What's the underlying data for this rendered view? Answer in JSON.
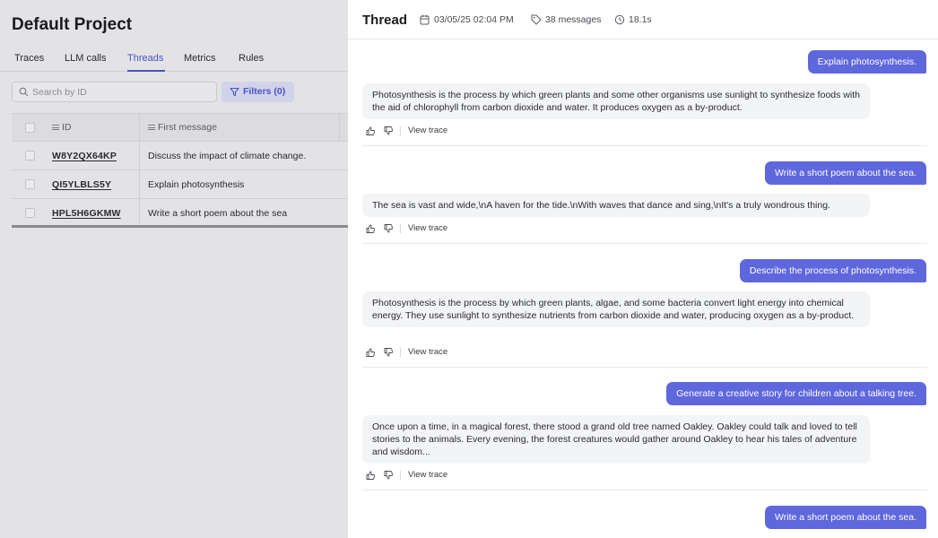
{
  "project": {
    "title": "Default Project"
  },
  "tabs": [
    {
      "label": "Traces"
    },
    {
      "label": "LLM calls"
    },
    {
      "label": "Threads",
      "active": true
    },
    {
      "label": "Metrics"
    },
    {
      "label": "Rules"
    }
  ],
  "search": {
    "placeholder": "Search by ID",
    "value": ""
  },
  "filters": {
    "label": "Filters (0)"
  },
  "table": {
    "headers": {
      "id": "ID",
      "first_message": "First message"
    },
    "rows": [
      {
        "id": "W8Y2QX64KP",
        "first_message": "Discuss the impact of climate change."
      },
      {
        "id": "QI5YLBLS5Y",
        "first_message": "Explain photosynthesis"
      },
      {
        "id": "HPL5H6GKMW",
        "first_message": "Write a short poem about the sea"
      }
    ]
  },
  "thread": {
    "title": "Thread",
    "date": "03/05/25 02:04 PM",
    "messages_count": "38 messages",
    "duration": "18.1s",
    "view_trace_label": "View trace",
    "exchanges": [
      {
        "user": "Explain photosynthesis.",
        "assistant": "Photosynthesis is the process by which green plants and some other organisms use sunlight to synthesize foods with the aid of chlorophyll from carbon dioxide and water. It produces oxygen as a by-product."
      },
      {
        "user": "Write a short poem about the sea.",
        "assistant": "The sea is vast and wide,\\nA haven for the tide.\\nWith waves that dance and sing,\\nIt's a truly wondrous thing."
      },
      {
        "user": "Describe the process of photosynthesis.",
        "assistant": "Photosynthesis is the process by which green plants, algae, and some bacteria convert light energy into chemical energy. They use sunlight to synthesize nutrients from carbon dioxide and water, producing oxygen as a by-product."
      },
      {
        "user": "Generate a creative story for children about a talking tree.",
        "assistant": "Once upon a time, in a magical forest, there stood a grand old tree named Oakley. Oakley could talk and loved to tell stories to the animals. Every evening, the forest creatures would gather around Oakley to hear his tales of adventure and wisdom..."
      },
      {
        "user": "Write a short poem about the sea."
      }
    ]
  },
  "colors": {
    "accent": "#4a52c9",
    "user_bubble": "#5f67dd"
  }
}
